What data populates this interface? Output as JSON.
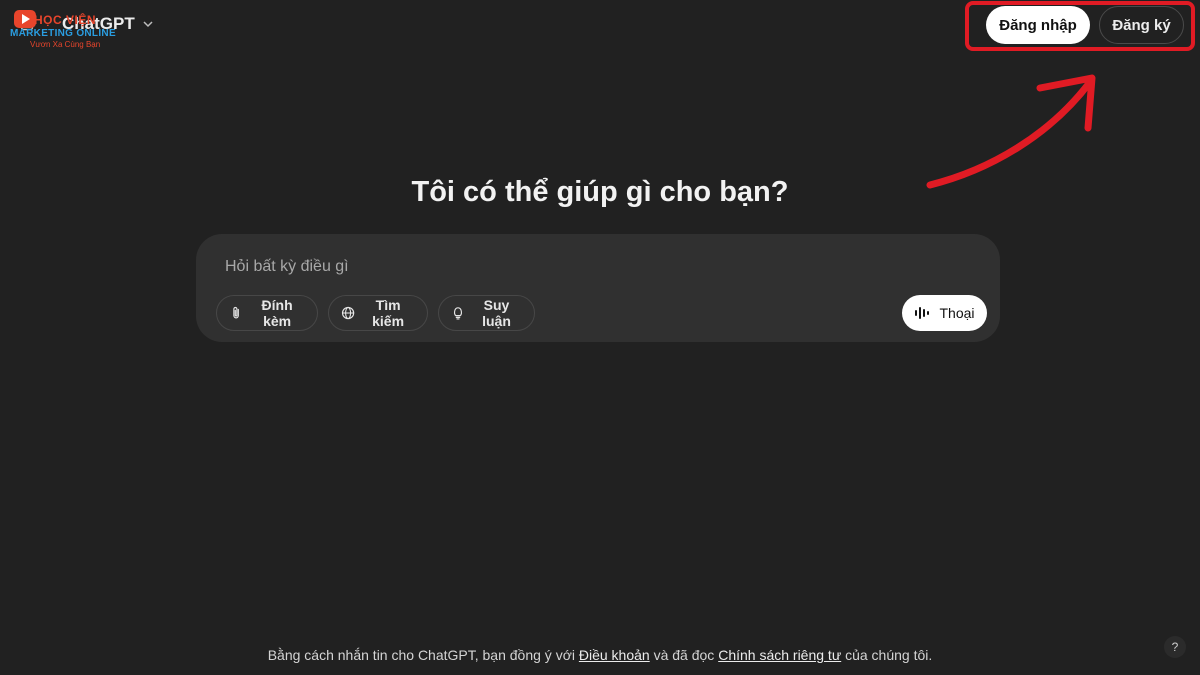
{
  "watermark": {
    "line1": "HỌC VIỆN",
    "line2": "MARKETING ONLINE",
    "line3": "Vươn Xa Cùng Bạn"
  },
  "header": {
    "model_name": "ChatGPT",
    "login_label": "Đăng nhập",
    "signup_label": "Đăng ký"
  },
  "main": {
    "heading": "Tôi có thể giúp gì cho bạn?",
    "composer": {
      "placeholder": "Hỏi bất kỳ điều gì",
      "tools": [
        "Đính kèm",
        "Tìm kiếm",
        "Suy luận"
      ],
      "voice_label": "Thoại"
    }
  },
  "footer": {
    "prefix": "Bằng cách nhắn tin cho ChatGPT, bạn đồng ý với ",
    "terms_link": "Điều khoản",
    "middle": " và đã đọc ",
    "privacy_link": "Chính sách riêng tư",
    "suffix": " của chúng tôi.",
    "help_label": "?"
  },
  "colors": {
    "background": "#212121",
    "composer": "#303030",
    "annotation": "#e01b24"
  }
}
